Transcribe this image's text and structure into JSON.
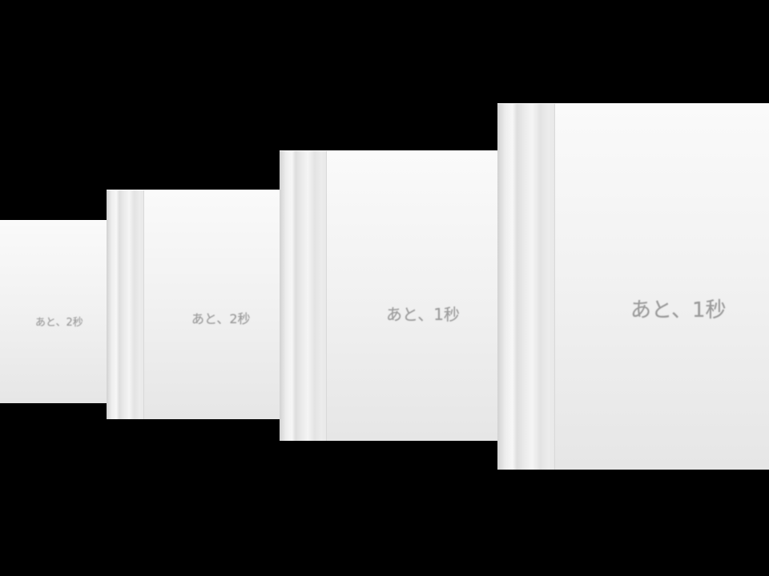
{
  "theme": {
    "background": "#000000",
    "card_color": "#f0f0f0",
    "label_color": "#9a9a9a"
  },
  "cards": [
    {
      "label": "あと、2秒"
    },
    {
      "label": "あと、2秒"
    },
    {
      "label": "あと、1秒"
    },
    {
      "label": "あと、1秒"
    }
  ]
}
